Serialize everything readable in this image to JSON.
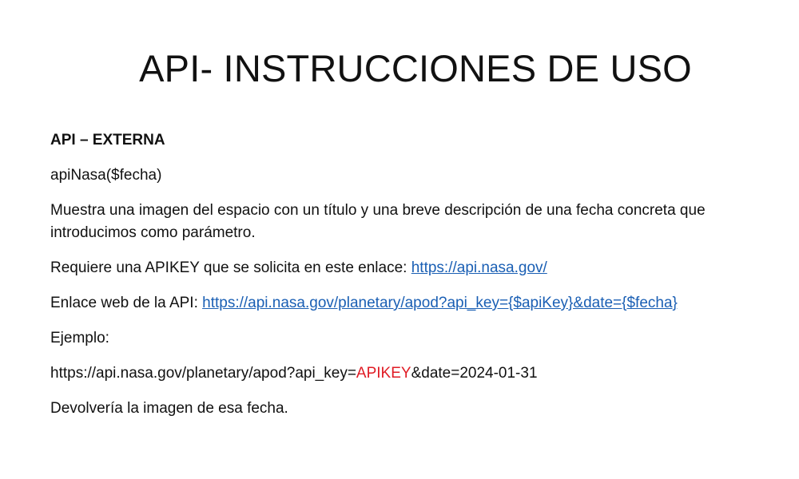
{
  "slide": {
    "title": "API- INSTRUCCIONES DE USO",
    "heading": "API – EXTERNA",
    "function_name": "apiNasa($fecha)",
    "description": "Muestra una imagen del espacio con un título y una breve descripción de una fecha concreta que introducimos como parámetro.",
    "apikey_text": "Requiere una APIKEY que se solicita en este enlace: ",
    "apikey_link": "https://api.nasa.gov/",
    "web_text": "Enlace web de la API: ",
    "web_link": "https://api.nasa.gov/planetary/apod?api_key={$apiKey}&date={$fecha}",
    "example_label": "Ejemplo:",
    "example_prefix": "https://api.nasa.gov/planetary/apod?api_key=",
    "example_key": "APIKEY",
    "example_suffix": "&date=2024-01-31",
    "closing": "Devolvería la imagen de esa fecha."
  },
  "colors": {
    "link": "#1a5fb4",
    "highlight": "#e01b24",
    "text": "#111111"
  }
}
